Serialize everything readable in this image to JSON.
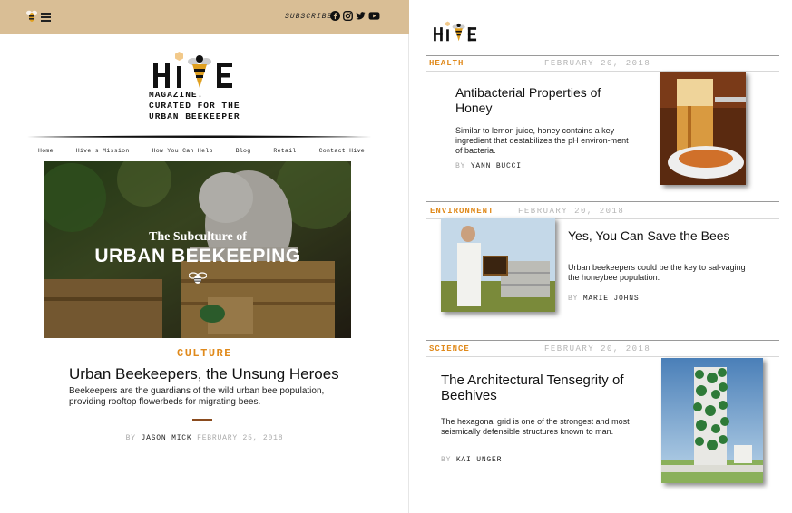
{
  "left": {
    "header": {
      "subscribe_label": "SUBSCRIBE",
      "social_icons": [
        "facebook-icon",
        "instagram-icon",
        "twitter-icon",
        "youtube-icon"
      ],
      "bar_color": "#d9be95"
    },
    "logo": {
      "text": "HIVE"
    },
    "tagline": "MAGAZINE.\nCURATED FOR THE\nURBAN BEEKEEPER",
    "nav": [
      "Home",
      "Hive's Mission",
      "How You Can Help",
      "Blog",
      "Retail",
      "Contact Hive"
    ],
    "hero": {
      "title_small": "The Subculture of",
      "title_large": "URBAN BEEKEEPING"
    },
    "featured": {
      "category": "CULTURE",
      "title": "Urban Beekeepers, the Unsung Heroes",
      "description": "Beekeepers are the guardians of the wild urban bee population, providing rooftop flowerbeds for migrating bees.",
      "by_label": "BY",
      "author": "JASON MICK",
      "date": "FEBRUARY 25, 2018"
    }
  },
  "right": {
    "logo": {
      "text": "HIVE"
    },
    "accent_color": "#e08a1c",
    "articles": [
      {
        "category": "HEALTH",
        "date": "FEBRUARY 20, 2018",
        "title": "Antibacterial Properties of Honey",
        "description": "Similar to lemon juice, honey contains a key ingredient that destabilizes the pH environ-ment of bacteria.",
        "by_label": "BY",
        "author": "YANN BUCCI"
      },
      {
        "category": "ENVIRONMENT",
        "date": "FEBRUARY 20, 2018",
        "title": "Yes, You Can Save the Bees",
        "description": "Urban beekeepers could be the key to sal-vaging the honeybee population.",
        "by_label": "BY",
        "author": "MARIE JOHNS"
      },
      {
        "category": "SCIENCE",
        "date": "FEBRUARY 20, 2018",
        "title": "The Architectural Tensegrity of Beehives",
        "description": "The hexagonal grid is one of the strongest and most seismically defensible structures known to man.",
        "by_label": "BY",
        "author": "KAI UNGER"
      }
    ]
  }
}
